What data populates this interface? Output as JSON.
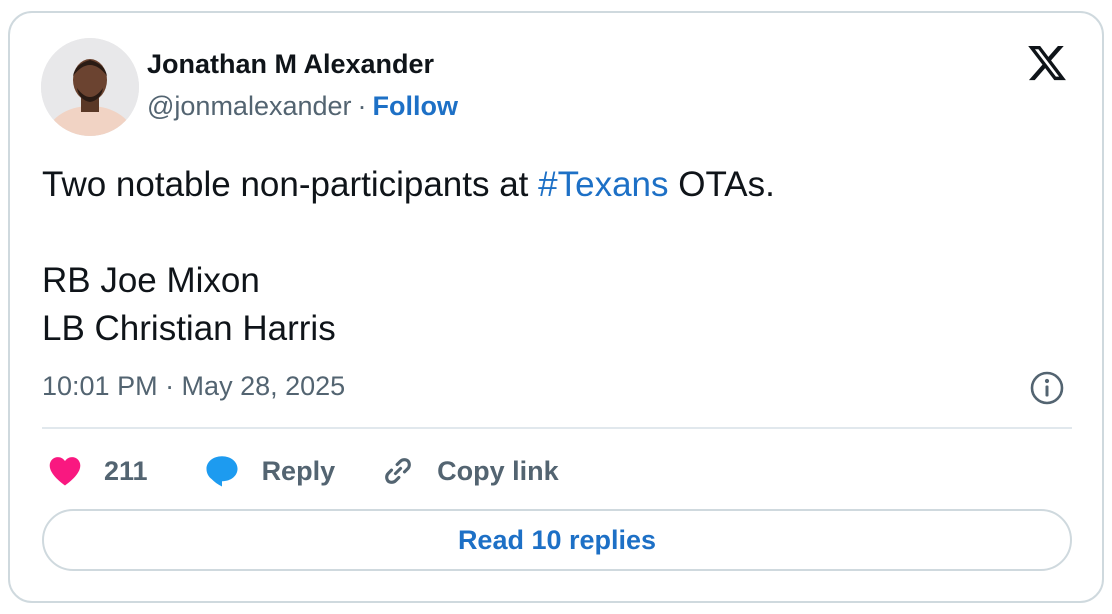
{
  "author": {
    "name": "Jonathan M Alexander",
    "handle": "@jonmalexander",
    "separator": "·",
    "follow_label": "Follow"
  },
  "brand": {
    "logo_icon": "x-logo-icon"
  },
  "tweet": {
    "line1_before": "Two notable non-participants at ",
    "hashtag": "#Texans",
    "line1_after": " OTAs.",
    "line2": "RB Joe Mixon",
    "line3": "LB Christian Harris",
    "timestamp": "10:01 PM · May 28, 2025"
  },
  "actions": {
    "like_count": "211",
    "reply_label": "Reply",
    "copy_link_label": "Copy link",
    "read_replies_label": "Read 10 replies"
  },
  "icons": {
    "like": "heart-icon",
    "reply": "speech-bubble-icon",
    "copy": "link-icon",
    "info": "info-icon"
  },
  "colors": {
    "link_blue": "#1d70c6",
    "heart_pink": "#f91880",
    "reply_blue": "#1d9bf0",
    "muted_gray": "#536471",
    "border": "#cfd9de"
  }
}
